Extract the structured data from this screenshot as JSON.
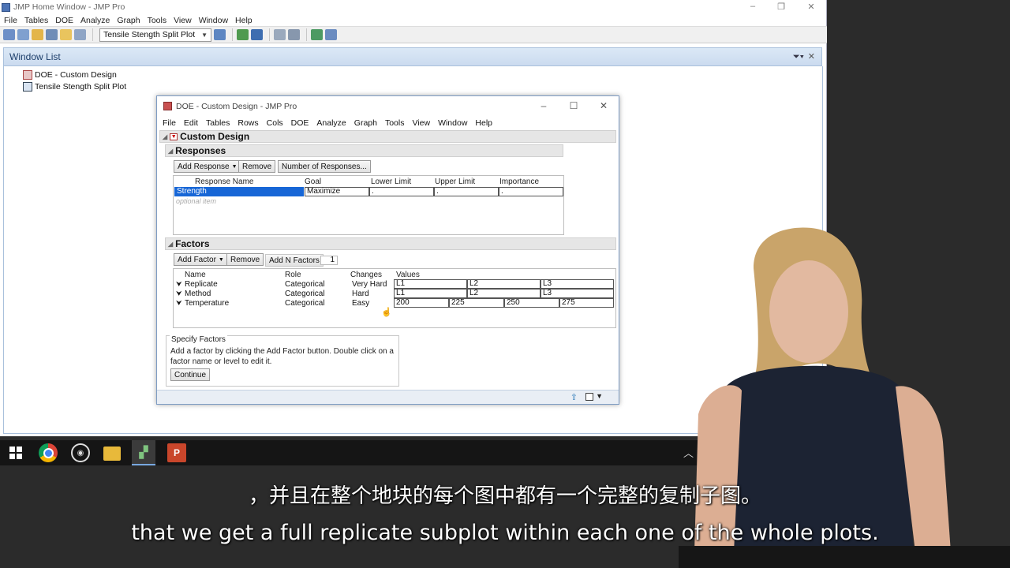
{
  "home_window": {
    "title": "JMP Home Window - JMP Pro",
    "menu": [
      "File",
      "Tables",
      "DOE",
      "Analyze",
      "Graph",
      "Tools",
      "View",
      "Window",
      "Help"
    ],
    "toolbar_combo": "Tensile Stength Split Plot",
    "window_list": {
      "header": "Window List",
      "items": [
        "DOE - Custom Design",
        "Tensile Stength Split Plot"
      ]
    }
  },
  "doe_window": {
    "title": "DOE - Custom Design - JMP Pro",
    "menu": [
      "File",
      "Edit",
      "Tables",
      "Rows",
      "Cols",
      "DOE",
      "Analyze",
      "Graph",
      "Tools",
      "View",
      "Window",
      "Help"
    ],
    "custom_design_title": "Custom Design",
    "responses": {
      "title": "Responses",
      "add_response_label": "Add Response",
      "remove_label": "Remove",
      "number_of_responses_label": "Number of Responses...",
      "columns": [
        "Response Name",
        "Goal",
        "Lower Limit",
        "Upper Limit",
        "Importance"
      ],
      "rows": [
        {
          "name": "Strength",
          "goal": "Maximize",
          "lower": ".",
          "upper": ".",
          "importance": "."
        }
      ],
      "optional_item": "optional item"
    },
    "factors": {
      "title": "Factors",
      "add_factor_label": "Add Factor",
      "remove_label": "Remove",
      "add_n_factors_label": "Add N Factors",
      "n_factors_value": "1",
      "columns": [
        "Name",
        "Role",
        "Changes",
        "Values"
      ],
      "rows": [
        {
          "name": "Replicate",
          "role": "Categorical",
          "changes": "Very Hard",
          "values": [
            "L1",
            "L2",
            "L3"
          ]
        },
        {
          "name": "Method",
          "role": "Categorical",
          "changes": "Hard",
          "values": [
            "L1",
            "L2",
            "L3"
          ]
        },
        {
          "name": "Temperature",
          "role": "Categorical",
          "changes": "Easy",
          "values": [
            "200",
            "225",
            "250",
            "275"
          ]
        }
      ]
    },
    "specify_factors": {
      "title": "Specify Factors",
      "text": "Add a factor by clicking the Add Factor button. Double click on a factor name or level to edit it.",
      "continue_label": "Continue"
    }
  },
  "taskbar": {
    "icons": [
      "windows-start-icon",
      "chrome-icon",
      "obs-icon",
      "file-explorer-icon",
      "jmp-icon",
      "powerpoint-icon"
    ]
  },
  "subtitles": {
    "zh": "，并且在整个地块的每个图中都有一个完整的复制子图。",
    "en": "that we get a full replicate subplot within each one of the whole plots."
  },
  "colors": {
    "selection": "#1766d6",
    "window_list_header": "#cbdbef",
    "taskbar": "#151515"
  }
}
